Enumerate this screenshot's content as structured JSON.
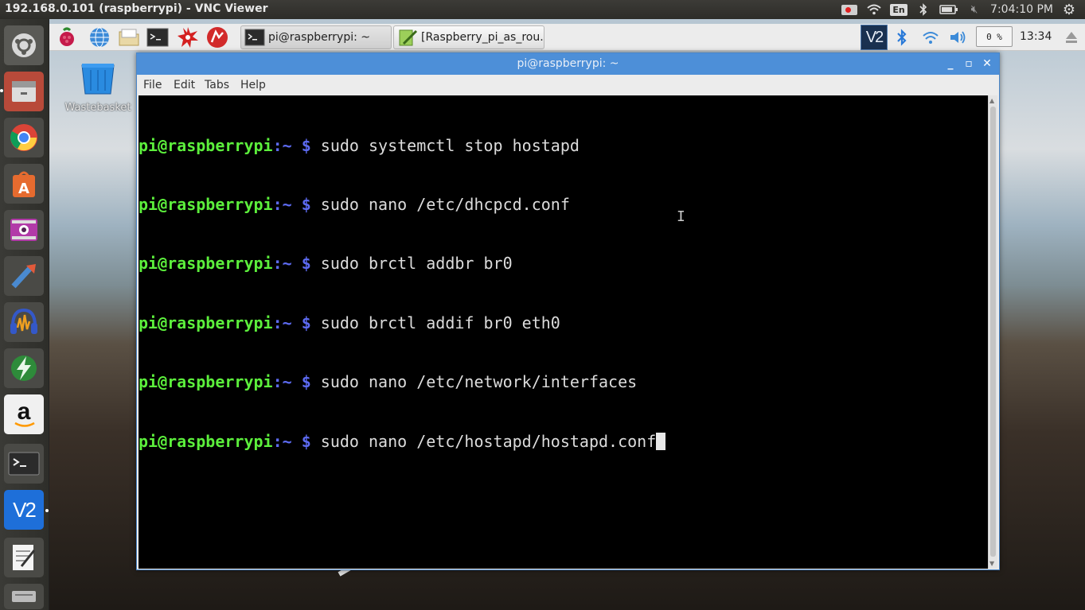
{
  "host": {
    "title": "192.168.0.101 (raspberrypi) - VNC Viewer",
    "keyboard_layout": "En",
    "clock": "7:04:10 PM",
    "indicators": [
      "record-icon",
      "wifi-icon",
      "keyboard-icon",
      "bluetooth-icon",
      "battery-icon",
      "volume-muted-icon",
      "settings-gear-icon"
    ]
  },
  "launcher": {
    "items": [
      "ubuntu-dash-icon",
      "files-icon",
      "chrome-icon",
      "software-center-icon",
      "webcam-icon",
      "tool-icon",
      "audacity-icon",
      "energy-icon",
      "amazon-icon",
      "terminal-icon",
      "vnc-viewer-icon",
      "text-editor-icon",
      "drive-icon"
    ],
    "amazon_glyph": "a",
    "vnc_glyph": "V2"
  },
  "pi_taskbar": {
    "tasks": [
      {
        "label": "pi@raspberrypi: ~"
      },
      {
        "label": "[Raspberry_pi_as_rou..."
      }
    ],
    "vnc_glyph": "V2",
    "cpu": "0 %",
    "clock": "13:34"
  },
  "desktop": {
    "icons": [
      {
        "label": "Wastebasket"
      }
    ]
  },
  "terminal": {
    "title": "pi@raspberrypi: ~",
    "menu": [
      "File",
      "Edit",
      "Tabs",
      "Help"
    ],
    "prompt_user": "pi@raspberrypi",
    "prompt_path": ":~ $ ",
    "lines": [
      "sudo systemctl stop hostapd",
      "sudo nano /etc/dhcpcd.conf",
      "sudo brctl addbr br0",
      "sudo brctl addif br0 eth0",
      "sudo nano /etc/network/interfaces",
      "sudo nano /etc/hostapd/hostapd.conf"
    ],
    "colors": {
      "user": "#5cef3c",
      "path": "#5d6bf2",
      "text": "#dcdcdc",
      "titlebar": "#4d8fd8"
    }
  }
}
